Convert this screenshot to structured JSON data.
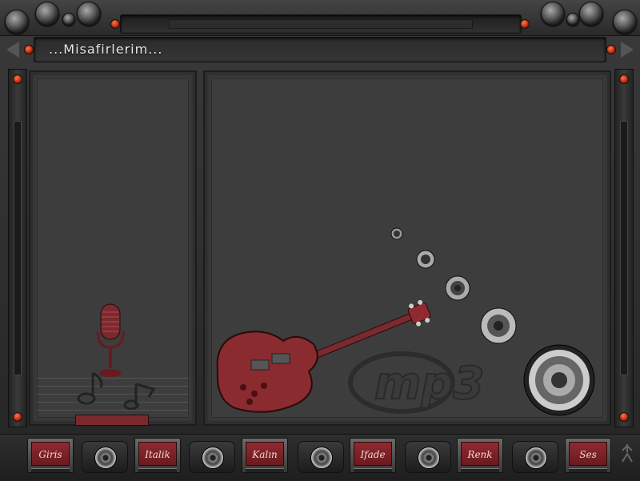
{
  "window": {
    "title": "...Misafirlerim..."
  },
  "logo": {
    "text": "mp3"
  },
  "mic_plate": {
    "label": ""
  },
  "toolbar": {
    "buttons": [
      {
        "label": "Giris"
      },
      {
        "label": "Italik"
      },
      {
        "label": "Kalın"
      },
      {
        "label": "Ifade"
      },
      {
        "label": "Renk"
      },
      {
        "label": "Ses"
      }
    ]
  },
  "icons": {
    "guitar": "guitar-icon",
    "microphone": "microphone-icon",
    "speaker": "speaker-icon",
    "music_note": "music-note-icon"
  },
  "colors": {
    "accent_red": "#8f2a30",
    "dark_bg": "#2b2b2b",
    "panel": "#3a3a3a"
  }
}
